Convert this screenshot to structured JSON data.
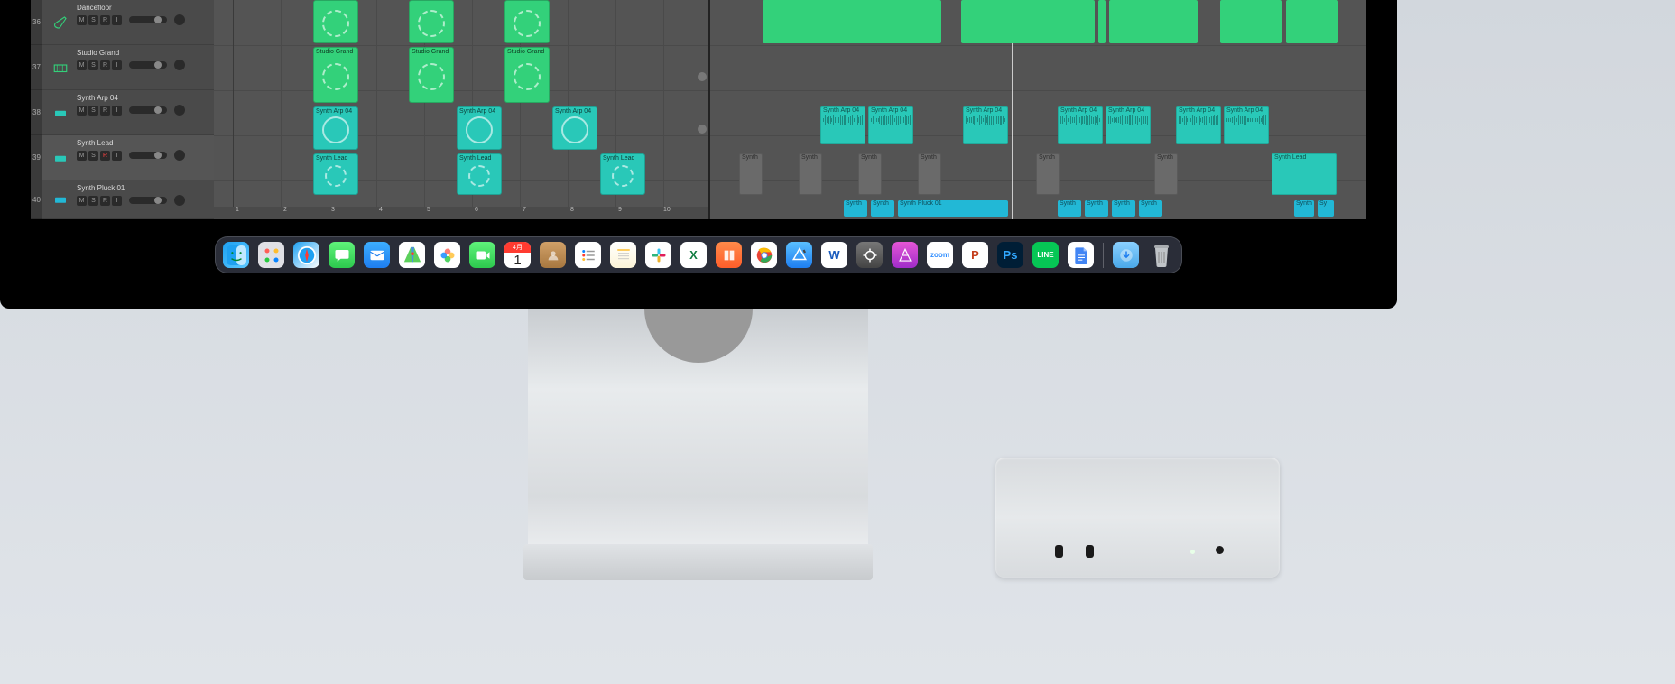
{
  "tracks": [
    {
      "num": "36",
      "name": "Dancefloor",
      "icon": "guitar",
      "iconColor": "#33d17a"
    },
    {
      "num": "37",
      "name": "Studio Grand",
      "icon": "piano",
      "iconColor": "#33d17a"
    },
    {
      "num": "38",
      "name": "Synth Arp 04",
      "icon": "synth",
      "iconColor": "#29c8b8"
    },
    {
      "num": "39",
      "name": "Synth Lead",
      "icon": "synth2",
      "iconColor": "#29c8b8"
    },
    {
      "num": "40",
      "name": "Synth Pluck 01",
      "icon": "synth3",
      "iconColor": "#22b8d6"
    }
  ],
  "track_btns": {
    "m": "M",
    "s": "S",
    "r": "R",
    "i": "I"
  },
  "ruler_left": [
    "1",
    "2",
    "3",
    "4",
    "5",
    "6",
    "7",
    "8",
    "9",
    "10"
  ],
  "clips_left": {
    "dancefloor_label": "",
    "studio_label": "Studio Grand",
    "arp_label": "Synth Arp 04",
    "lead_label": "Synth Lead"
  },
  "clips_right": {
    "arp_label": "Synth Arp 04",
    "synth_short": "Synth",
    "lead_label": "Synth Lead",
    "pluck_label": "Synth Pluck 01",
    "sy_short": "Sy"
  },
  "dock": [
    {
      "name": "finder",
      "bg": "linear-gradient(135deg,#1ea1f2,#5dc8ff)"
    },
    {
      "name": "launchpad",
      "bg": "#e0e0e5"
    },
    {
      "name": "safari",
      "bg": "linear-gradient(135deg,#1ea1f2,#fff)"
    },
    {
      "name": "messages",
      "bg": "linear-gradient(180deg,#5ff27a,#2dc94e)"
    },
    {
      "name": "mail",
      "bg": "linear-gradient(180deg,#3daeff,#1e7ef0)"
    },
    {
      "name": "maps",
      "bg": "#fff"
    },
    {
      "name": "photos",
      "bg": "#fff"
    },
    {
      "name": "facetime",
      "bg": "linear-gradient(180deg,#5ff27a,#2dc94e)"
    },
    {
      "name": "calendar",
      "bg": "#fff",
      "top_label": "4月",
      "day": "1"
    },
    {
      "name": "contacts",
      "bg": "linear-gradient(180deg,#d0a068,#a87840)"
    },
    {
      "name": "reminders",
      "bg": "#fff"
    },
    {
      "name": "notes",
      "bg": "linear-gradient(180deg,#fff,#fdf5d8)"
    },
    {
      "name": "slack",
      "bg": "#fff"
    },
    {
      "name": "excel",
      "bg": "#fff",
      "label": "X",
      "labelColor": "#107c41"
    },
    {
      "name": "books",
      "bg": "linear-gradient(180deg,#ff8a4a,#ff5e2a)"
    },
    {
      "name": "chrome",
      "bg": "#fff"
    },
    {
      "name": "xcode",
      "bg": "linear-gradient(180deg,#5abfff,#1e7ef0)"
    },
    {
      "name": "word",
      "bg": "#fff",
      "label": "W",
      "labelColor": "#185abd"
    },
    {
      "name": "shortcuts",
      "bg": "linear-gradient(180deg,#777,#444)"
    },
    {
      "name": "affinity",
      "bg": "linear-gradient(180deg,#e556d6,#a02cc9)"
    },
    {
      "name": "zoom",
      "bg": "#fff",
      "label": "zoom",
      "labelColor": "#2d8cff"
    },
    {
      "name": "powerpoint",
      "bg": "#fff",
      "label": "P",
      "labelColor": "#c43e1c"
    },
    {
      "name": "photoshop",
      "bg": "#001e36",
      "label": "Ps",
      "labelColor": "#31a8ff"
    },
    {
      "name": "line",
      "bg": "#06c755",
      "label": "LINE",
      "labelColor": "#fff"
    },
    {
      "name": "google-docs",
      "bg": "#fff"
    },
    {
      "name": "downloads",
      "bg": "linear-gradient(180deg,#8ad0ff,#4aa8e8)"
    },
    {
      "name": "trash",
      "bg": "transparent"
    }
  ]
}
